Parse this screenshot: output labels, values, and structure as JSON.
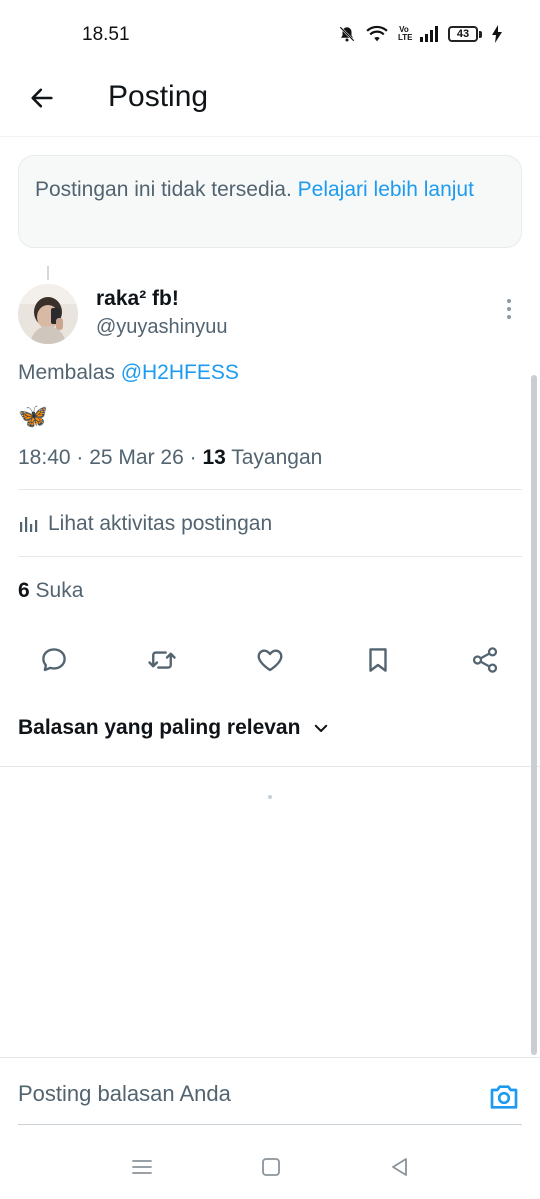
{
  "status_bar": {
    "time": "18.51",
    "volte_top": "Vo",
    "volte_bottom": "LTE",
    "battery": "43"
  },
  "header": {
    "title": "Posting"
  },
  "notice": {
    "text": "Postingan ini tidak tersedia. ",
    "link": "Pelajari lebih lanjut"
  },
  "post": {
    "author_name": "raka² fb!",
    "author_handle": "@yuyashinyuu",
    "reply_prefix": "Membalas ",
    "reply_handle": "@H2HFESS",
    "body": "🦋",
    "time": "18:40 · 25 Mar 26 · ",
    "views_count": "13",
    "views_label": " Tayangan",
    "activity_label": "Lihat aktivitas postingan",
    "likes_count": "6",
    "likes_label": " Suka"
  },
  "actions": [
    "reply-icon",
    "retweet-icon",
    "like-icon",
    "bookmark-icon",
    "share-icon"
  ],
  "replies": {
    "sort_label": "Balasan yang paling relevan"
  },
  "compose": {
    "placeholder": "Posting balasan Anda"
  },
  "colors": {
    "accent": "#1d9bf0",
    "text_primary": "#0f1419",
    "text_secondary": "#536471"
  }
}
